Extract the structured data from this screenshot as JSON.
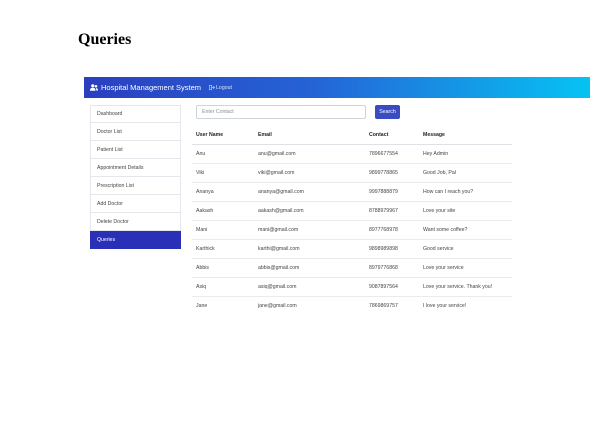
{
  "page_heading": "Queries",
  "navbar": {
    "brand_icon": "users-icon",
    "brand": "Hospital Management System",
    "logout_icon": "logout-icon",
    "logout": "Logout",
    "gradient": [
      "#2b3fbf",
      "#06c3f3"
    ]
  },
  "sidebar": {
    "items": [
      {
        "label": "Dashboard"
      },
      {
        "label": "Doctor List"
      },
      {
        "label": "Patient List"
      },
      {
        "label": "Appointment Details"
      },
      {
        "label": "Prescription List"
      },
      {
        "label": "Add Doctor"
      },
      {
        "label": "Delete Doctor"
      },
      {
        "label": "Queries"
      }
    ],
    "active_label": "Queries",
    "active_color": "#2a2fb8"
  },
  "search": {
    "placeholder": "Enter Contact",
    "value": "",
    "button_label": "Search",
    "button_color": "#3a4cc2"
  },
  "table": {
    "columns": [
      "User Name",
      "Email",
      "Contact",
      "Message"
    ],
    "rows": [
      [
        "Anu",
        "anu@gmail.com",
        "7896677554",
        "Hey Admin"
      ],
      [
        "Viki",
        "viki@gmail.com",
        "9899778865",
        "Good Job, Pal"
      ],
      [
        "Ananya",
        "ananya@gmail.com",
        "9997888879",
        "How can I reach you?"
      ],
      [
        "Aakash",
        "aakash@gmail.com",
        "8788979967",
        "Love your site"
      ],
      [
        "Mani",
        "mani@gmail.com",
        "8977768978",
        "Want some coffee?"
      ],
      [
        "Karthick",
        "karthi@gmail.com",
        "9898989898",
        "Good service"
      ],
      [
        "Abbis",
        "abbis@gmail.com",
        "8979776868",
        "Love your service"
      ],
      [
        "Asiq",
        "asiq@gmail.com",
        "9087897564",
        "Love your service. Thank you!"
      ],
      [
        "Jane",
        "jane@gmail.com",
        "7869869757",
        "I love your service!"
      ]
    ]
  }
}
